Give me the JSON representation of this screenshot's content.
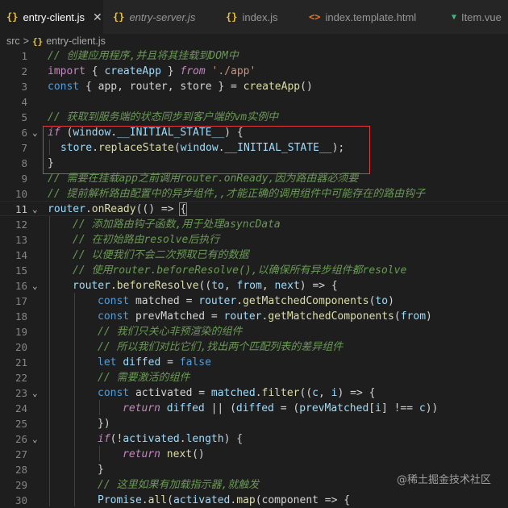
{
  "tabs": [
    {
      "icon": "{}",
      "label": "entry-client.js",
      "close": "✕",
      "icon_color": "#e8c13a"
    },
    {
      "icon": "{}",
      "label": "entry-server.js",
      "icon_color": "#e8c13a"
    },
    {
      "icon": "{}",
      "label": "index.js",
      "icon_color": "#e8c13a"
    },
    {
      "icon": "<>",
      "label": "index.template.html",
      "icon_color": "#e37933"
    },
    {
      "icon": "▼",
      "label": "Item.vue",
      "icon_color": "#41b883"
    }
  ],
  "breadcrumb": {
    "folder": "src",
    "sep": ">",
    "file_icon": "{}",
    "file": "entry-client.js"
  },
  "line_numbers": [
    "1",
    "2",
    "3",
    "4",
    "5",
    "6",
    "7",
    "8",
    "9",
    "10",
    "11",
    "12",
    "13",
    "14",
    "15",
    "16",
    "17",
    "18",
    "19",
    "20",
    "21",
    "22",
    "23",
    "24",
    "25",
    "26",
    "27",
    "28",
    "29",
    "30"
  ],
  "code": {
    "l1_comment": "// 创建应用程序,并且将其挂载到DOM中",
    "l2": {
      "import": "import",
      "open": " { ",
      "name": "createApp",
      "close": " } ",
      "from": "from",
      "sp": " ",
      "path": "'./app'"
    },
    "l3": {
      "const": "const",
      "open": " { ",
      "a": "app",
      "c1": ", ",
      "b": "router",
      "c2": ", ",
      "c": "store",
      "close": " } = ",
      "fn": "createApp",
      "call": "()"
    },
    "l5_comment": "// 获取到服务端的状态同步到客户端的vm实例中",
    "l6": {
      "if": "if",
      "open": " (",
      "window": "window",
      "dot": ".",
      "state": "__INITIAL_STATE__",
      "close": ") {"
    },
    "l7": {
      "store": "store",
      "dot": ".",
      "method": "replaceState",
      "open": "(",
      "window": "window",
      "dot2": ".",
      "state": "__INITIAL_STATE__",
      "close": ");"
    },
    "l8": "}",
    "l9_comment": "// 需要在挂载app之前调用router.onReady,因为路由器必须要",
    "l10_comment": "// 提前解析路由配置中的异步组件,,才能正确的调用组件中可能存在的路由钩子",
    "l11": {
      "router": "router",
      "dot": ".",
      "method": "onReady",
      "open": "(() => ",
      "brace": "{"
    },
    "l12_comment": "// 添加路由钩子函数,用于处理asyncData",
    "l13_comment": "// 在初始路由resolve后执行",
    "l14_comment": "// 以便我们不会二次预取已有的数据",
    "l15_comment": "// 使用router.beforeResolve(),以确保所有异步组件都resolve",
    "l16": {
      "router": "router",
      "dot": ".",
      "method": "beforeResolve",
      "open": "((",
      "to": "to",
      "c1": ", ",
      "from": "from",
      "c2": ", ",
      "next": "next",
      "close": ") => {"
    },
    "l17": {
      "const": "const",
      "sp": " ",
      "name": "matched",
      "eq": " = ",
      "router": "router",
      "dot": ".",
      "method": "getMatchedComponents",
      "open": "(",
      "arg": "to",
      "close": ")"
    },
    "l18": {
      "const": "const",
      "sp": " ",
      "name": "prevMatched",
      "eq": " = ",
      "router": "router",
      "dot": ".",
      "method": "getMatchedComponents",
      "open": "(",
      "arg": "from",
      "close": ")"
    },
    "l19_comment": "// 我们只关心非预渲染的组件",
    "l20_comment": "// 所以我们对比它们,找出两个匹配列表的差异组件",
    "l21": {
      "let": "let",
      "sp": " ",
      "name": "diffed",
      "eq": " = ",
      "val": "false"
    },
    "l22_comment": "// 需要激活的组件",
    "l23": {
      "const": "const",
      "sp": " ",
      "name": "activated",
      "eq": " = ",
      "m": "matched",
      "dot": ".",
      "method": "filter",
      "open": "((",
      "c": "c",
      "c1": ", ",
      "i": "i",
      "close": ") => {"
    },
    "l24": {
      "return": "return",
      "sp": " ",
      "diffed": "diffed",
      "or": " || (",
      "diffed2": "diffed",
      "eq": " = (",
      "pm": "prevMatched",
      "idx": "[",
      "i": "i",
      "idx2": "] !== ",
      "c": "c",
      "close": "))"
    },
    "l25": "})",
    "l26": {
      "if": "if",
      "open": "(!",
      "act": "activated",
      "dot": ".",
      "len": "length",
      "close": ") {"
    },
    "l27": {
      "return": "return",
      "sp": " ",
      "next": "next",
      "call": "()"
    },
    "l28": "}",
    "l29_comment": "// 这里如果有加载指示器,就触发",
    "l30": {
      "p": "Promise",
      "dot": ".",
      "all": "all",
      "open": "(",
      "act": "activated",
      "dot2": ".",
      "map": "map",
      "rest": "(component => {"
    }
  },
  "watermark": "@稀土掘金技术社区"
}
